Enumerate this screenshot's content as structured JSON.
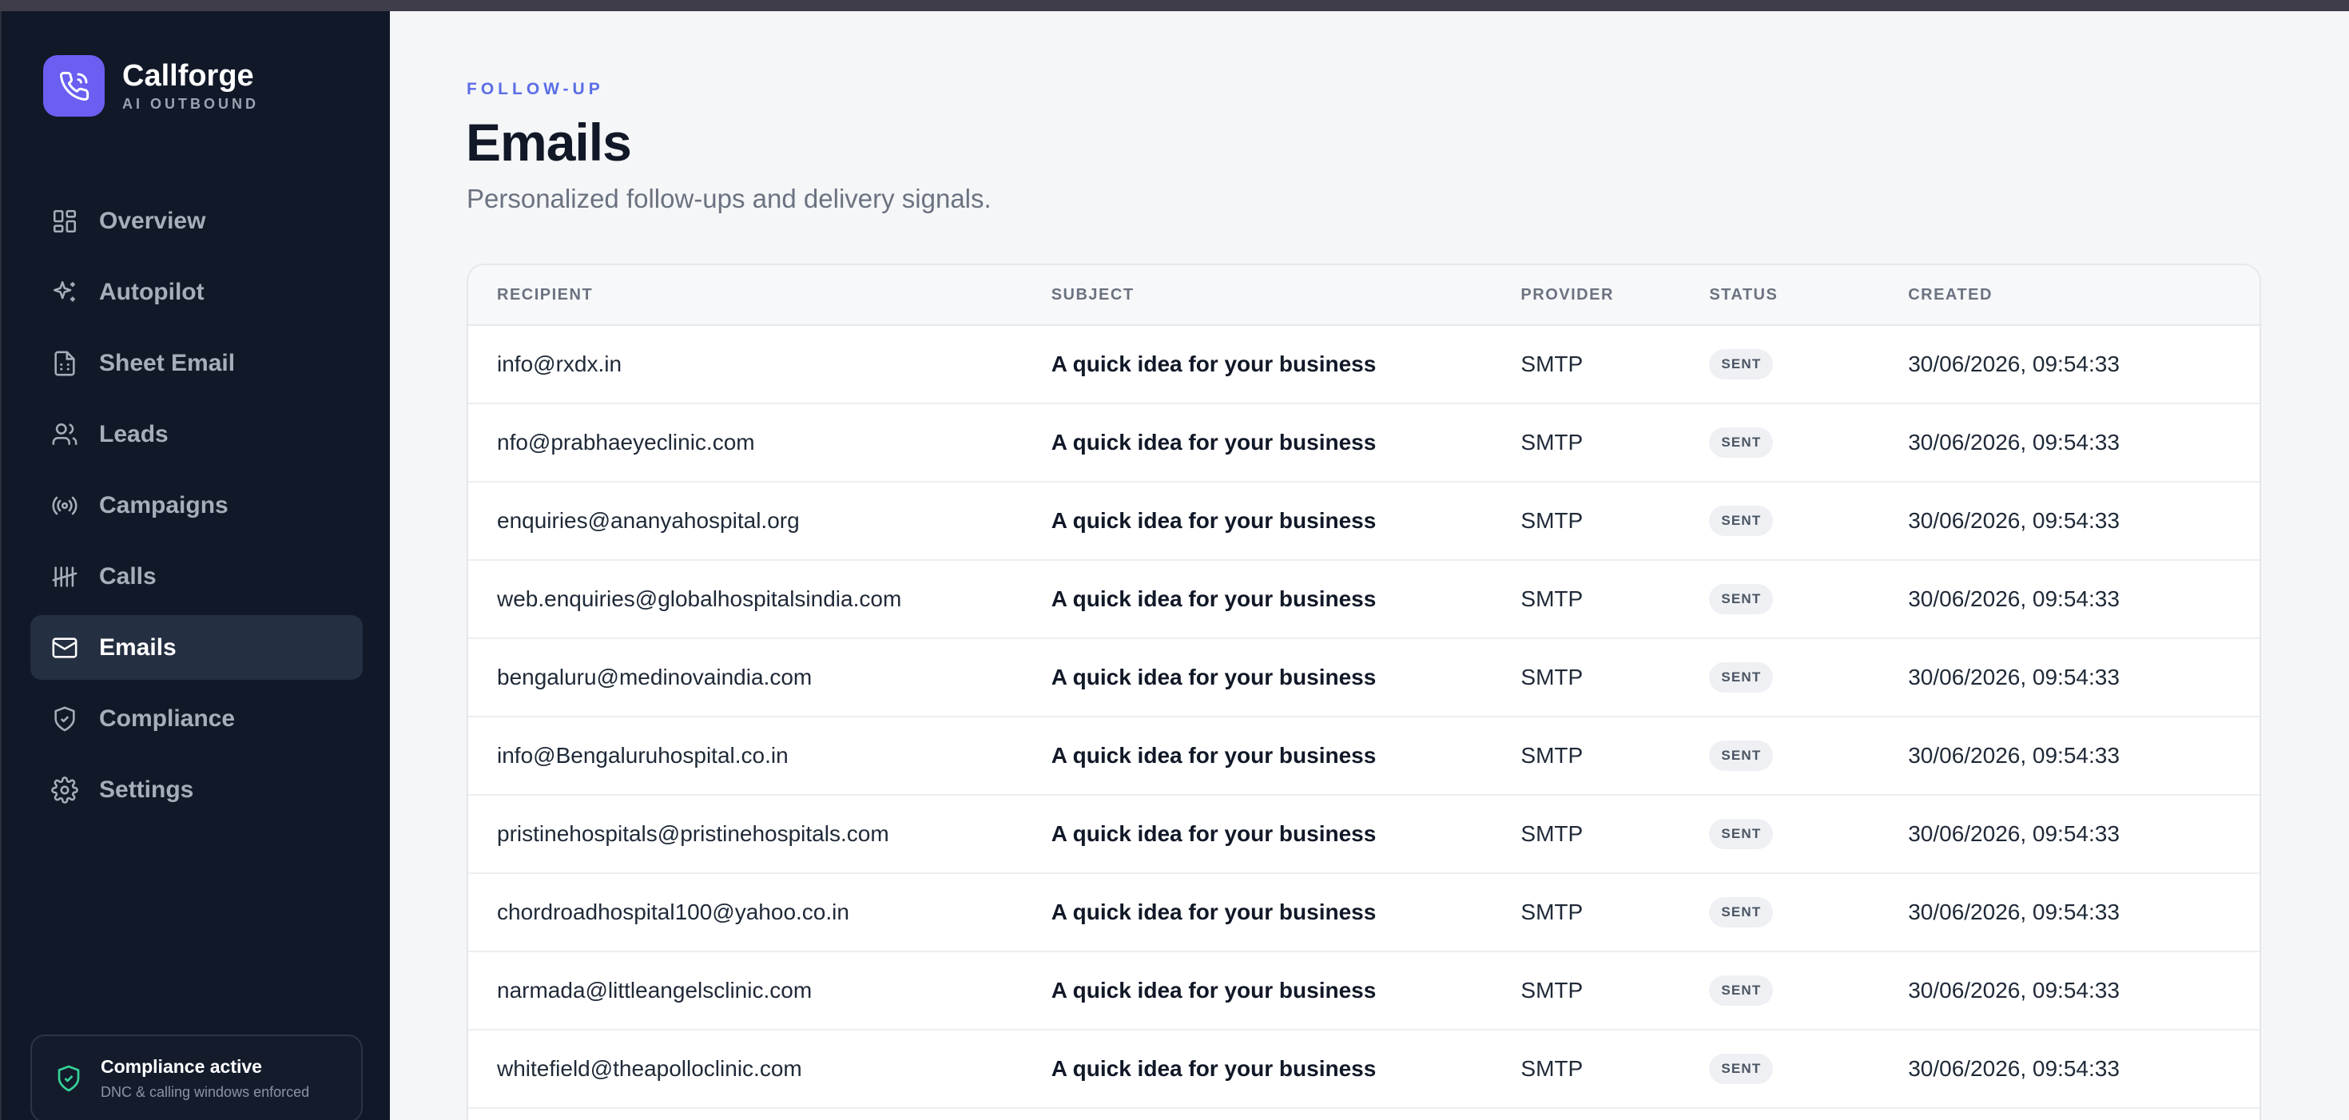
{
  "brand": {
    "name": "Callforge",
    "subtitle": "AI OUTBOUND"
  },
  "sidebar": {
    "items": [
      {
        "label": "Overview",
        "icon": "layout-grid-icon",
        "active": false
      },
      {
        "label": "Autopilot",
        "icon": "sparkles-icon",
        "active": false
      },
      {
        "label": "Sheet Email",
        "icon": "sheet-document-icon",
        "active": false
      },
      {
        "label": "Leads",
        "icon": "users-icon",
        "active": false
      },
      {
        "label": "Campaigns",
        "icon": "broadcast-icon",
        "active": false
      },
      {
        "label": "Calls",
        "icon": "tally-icon",
        "active": false
      },
      {
        "label": "Emails",
        "icon": "mail-icon",
        "active": true
      },
      {
        "label": "Compliance",
        "icon": "shield-check-icon",
        "active": false
      },
      {
        "label": "Settings",
        "icon": "gear-icon",
        "active": false
      }
    ],
    "compliance_card": {
      "title": "Compliance active",
      "subtitle": "DNC & calling windows enforced"
    }
  },
  "header": {
    "eyebrow": "FOLLOW-UP",
    "title": "Emails",
    "subtitle": "Personalized follow-ups and delivery signals."
  },
  "table": {
    "columns": [
      "RECIPIENT",
      "SUBJECT",
      "PROVIDER",
      "STATUS",
      "CREATED"
    ],
    "rows": [
      {
        "recipient": "info@rxdx.in",
        "subject": "A quick idea for your business",
        "provider": "SMTP",
        "status": "SENT",
        "created": "30/06/2026, 09:54:33"
      },
      {
        "recipient": "nfo@prabhaeyeclinic.com",
        "subject": "A quick idea for your business",
        "provider": "SMTP",
        "status": "SENT",
        "created": "30/06/2026, 09:54:33"
      },
      {
        "recipient": "enquiries@ananyahospital.org",
        "subject": "A quick idea for your business",
        "provider": "SMTP",
        "status": "SENT",
        "created": "30/06/2026, 09:54:33"
      },
      {
        "recipient": "web.enquiries@globalhospitalsindia.com",
        "subject": "A quick idea for your business",
        "provider": "SMTP",
        "status": "SENT",
        "created": "30/06/2026, 09:54:33"
      },
      {
        "recipient": "bengaluru@medinovaindia.com",
        "subject": "A quick idea for your business",
        "provider": "SMTP",
        "status": "SENT",
        "created": "30/06/2026, 09:54:33"
      },
      {
        "recipient": "info@Bengaluruhospital.co.in",
        "subject": "A quick idea for your business",
        "provider": "SMTP",
        "status": "SENT",
        "created": "30/06/2026, 09:54:33"
      },
      {
        "recipient": "pristinehospitals@pristinehospitals.com",
        "subject": "A quick idea for your business",
        "provider": "SMTP",
        "status": "SENT",
        "created": "30/06/2026, 09:54:33"
      },
      {
        "recipient": "chordroadhospital100@yahoo.co.in",
        "subject": "A quick idea for your business",
        "provider": "SMTP",
        "status": "SENT",
        "created": "30/06/2026, 09:54:33"
      },
      {
        "recipient": "narmada@littleangelsclinic.com",
        "subject": "A quick idea for your business",
        "provider": "SMTP",
        "status": "SENT",
        "created": "30/06/2026, 09:54:33"
      },
      {
        "recipient": "whitefield@theapolloclinic.com",
        "subject": "A quick idea for your business",
        "provider": "SMTP",
        "status": "SENT",
        "created": "30/06/2026, 09:54:33"
      }
    ]
  },
  "colors": {
    "sidebar_bg": "#111827",
    "accent": "#6a5ff0",
    "eyebrow": "#5b6ee6",
    "compliance_green": "#34d399"
  }
}
